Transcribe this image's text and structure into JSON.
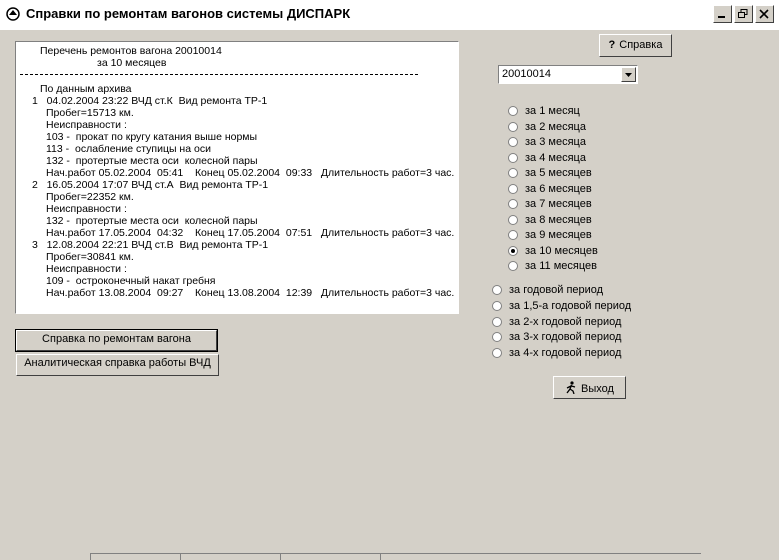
{
  "window": {
    "title": "Справки по ремонтам вагонов системы ДИСПАРК"
  },
  "report": {
    "lines": [
      "Перечень ремонтов вагона 20010014",
      "за 10 месяцев",
      "По данным архива",
      "1   04.02.2004 23:22 ВЧД ст.К  Вид ремонта ТР-1",
      "Пробег=15713 км.",
      "Неисправности :",
      "103 -  прокат по кругу катания выше нормы",
      "113 -  ослабление ступицы на оси",
      "132 -  протертые места оси  колесной пары",
      "Нач.работ 05.02.2004  05:41    Конец 05.02.2004  09:33   Длительность работ=3 час.",
      "2   16.05.2004 17:07 ВЧД ст.А  Вид ремонта ТР-1",
      "Пробег=22352 км.",
      "Неисправности :",
      "132 -  протертые места оси  колесной пары",
      "Нач.работ 17.05.2004  04:32    Конец 17.05.2004  07:51   Длительность работ=3 час.",
      "3   12.08.2004 22:21 ВЧД ст.В  Вид ремонта ТР-1",
      "Пробег=30841 км.",
      "Неисправности :",
      "109 -  остроконечный накат гребня",
      "Нач.работ 13.08.2004  09:27    Конец 13.08.2004  12:39   Длительность работ=3 час."
    ]
  },
  "buttons": {
    "repairs_report": "Справка по ремонтам вагона",
    "analytics_report": "Аналитическая справка работы ВЧД",
    "help": "Справка",
    "exit": "Выход"
  },
  "wagon_select": {
    "value": "20010014"
  },
  "period_months": {
    "options": [
      "за 1 месяц",
      "за 2 месяца",
      "за 3 месяца",
      "за 4 месяца",
      "за 5 месяцев",
      "за 6 месяцев",
      "за 7 месяцев",
      "за 8 месяцев",
      "за 9 месяцев",
      "за 10 месяцев",
      "за 11 месяцев"
    ],
    "selected": 9
  },
  "period_years": {
    "options": [
      "за годовой период",
      "за 1,5-а годовой период",
      "за 2-х годовой период",
      "за 3-х годовой период",
      "за 4-х годовой период"
    ],
    "selected": -1
  },
  "icons": {
    "app": "train-app-icon",
    "help": "question-icon",
    "exit": "running-man-icon"
  }
}
